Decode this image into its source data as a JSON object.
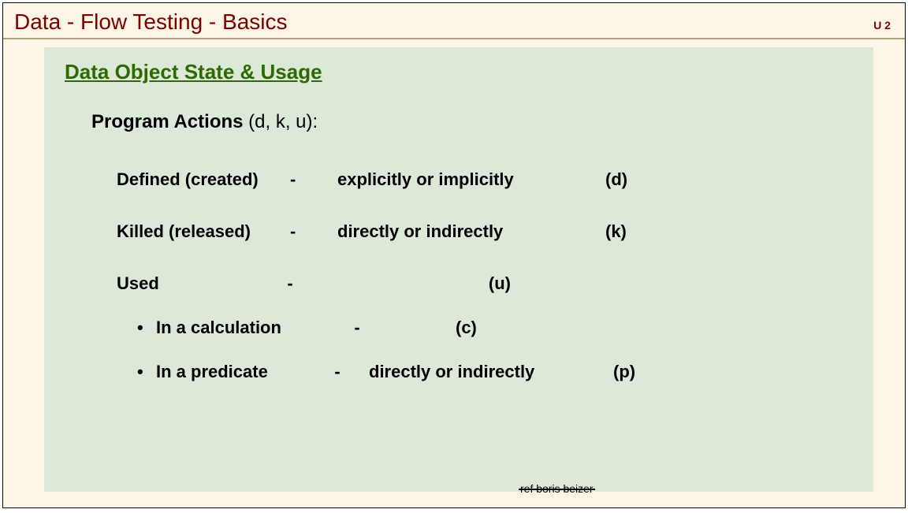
{
  "header": {
    "title": "Data - Flow Testing   -  Basics",
    "tag": "U 2"
  },
  "section": {
    "subtitle": "Data Object State  & Usage",
    "lead_label": "Program Actions ",
    "lead_params": "  (d, k, u):"
  },
  "rows": {
    "defined": {
      "name": "Defined (created)",
      "dash": "-",
      "expl": "explicitly  or implicitly",
      "tag": "(d)"
    },
    "killed": {
      "name": "Killed (released)",
      "dash": "-",
      "expl": "directly or indirectly",
      "tag": "(k)"
    },
    "used": {
      "name": "Used",
      "dash": "-",
      "tag": "(u)"
    },
    "calc": {
      "bullet": "•",
      "name": "In a  calculation",
      "dash": "-",
      "tag": "(c)"
    },
    "pred": {
      "bullet": "•",
      "name": "In a predicate",
      "dash": "-",
      "expl": "directly or indirectly",
      "tag": "(p)"
    }
  },
  "footer": {
    "ref": "ref boris beizer"
  }
}
